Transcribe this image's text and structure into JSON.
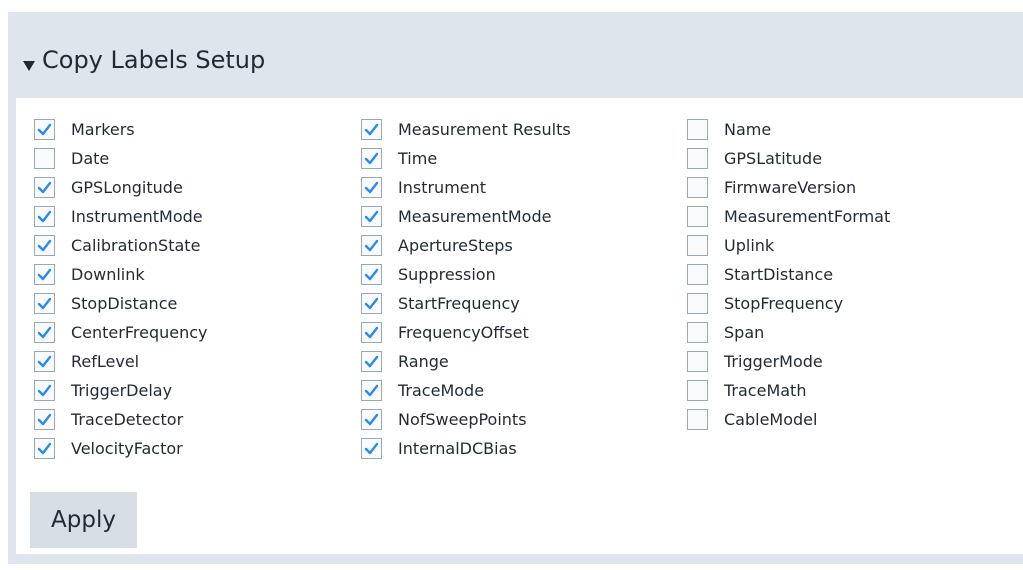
{
  "section": {
    "title": "Copy Labels Setup"
  },
  "columns": [
    [
      {
        "label": "Markers",
        "checked": true
      },
      {
        "label": "Date",
        "checked": false
      },
      {
        "label": "GPSLongitude",
        "checked": true
      },
      {
        "label": "InstrumentMode",
        "checked": true
      },
      {
        "label": "CalibrationState",
        "checked": true
      },
      {
        "label": "Downlink",
        "checked": true
      },
      {
        "label": "StopDistance",
        "checked": true
      },
      {
        "label": "CenterFrequency",
        "checked": true
      },
      {
        "label": "RefLevel",
        "checked": true
      },
      {
        "label": "TriggerDelay",
        "checked": true
      },
      {
        "label": "TraceDetector",
        "checked": true
      },
      {
        "label": "VelocityFactor",
        "checked": true
      }
    ],
    [
      {
        "label": "Measurement Results",
        "checked": true
      },
      {
        "label": "Time",
        "checked": true
      },
      {
        "label": "Instrument",
        "checked": true
      },
      {
        "label": "MeasurementMode",
        "checked": true
      },
      {
        "label": "ApertureSteps",
        "checked": true
      },
      {
        "label": "Suppression",
        "checked": true
      },
      {
        "label": "StartFrequency",
        "checked": true
      },
      {
        "label": "FrequencyOffset",
        "checked": true
      },
      {
        "label": "Range",
        "checked": true
      },
      {
        "label": "TraceMode",
        "checked": true
      },
      {
        "label": "NofSweepPoints",
        "checked": true
      },
      {
        "label": "InternalDCBias",
        "checked": true
      }
    ],
    [
      {
        "label": "Name",
        "checked": false
      },
      {
        "label": "GPSLatitude",
        "checked": false
      },
      {
        "label": "FirmwareVersion",
        "checked": false
      },
      {
        "label": "MeasurementFormat",
        "checked": false
      },
      {
        "label": "Uplink",
        "checked": false
      },
      {
        "label": "StartDistance",
        "checked": false
      },
      {
        "label": "StopFrequency",
        "checked": false
      },
      {
        "label": "Span",
        "checked": false
      },
      {
        "label": "TriggerMode",
        "checked": false
      },
      {
        "label": "TraceMath",
        "checked": false
      },
      {
        "label": "CableModel",
        "checked": false
      }
    ]
  ],
  "apply_label": "Apply",
  "colors": {
    "check": "#2b8be8",
    "header_bg": "#dfe5ec",
    "button_bg": "#d7dee6",
    "text": "#1f2a36"
  }
}
